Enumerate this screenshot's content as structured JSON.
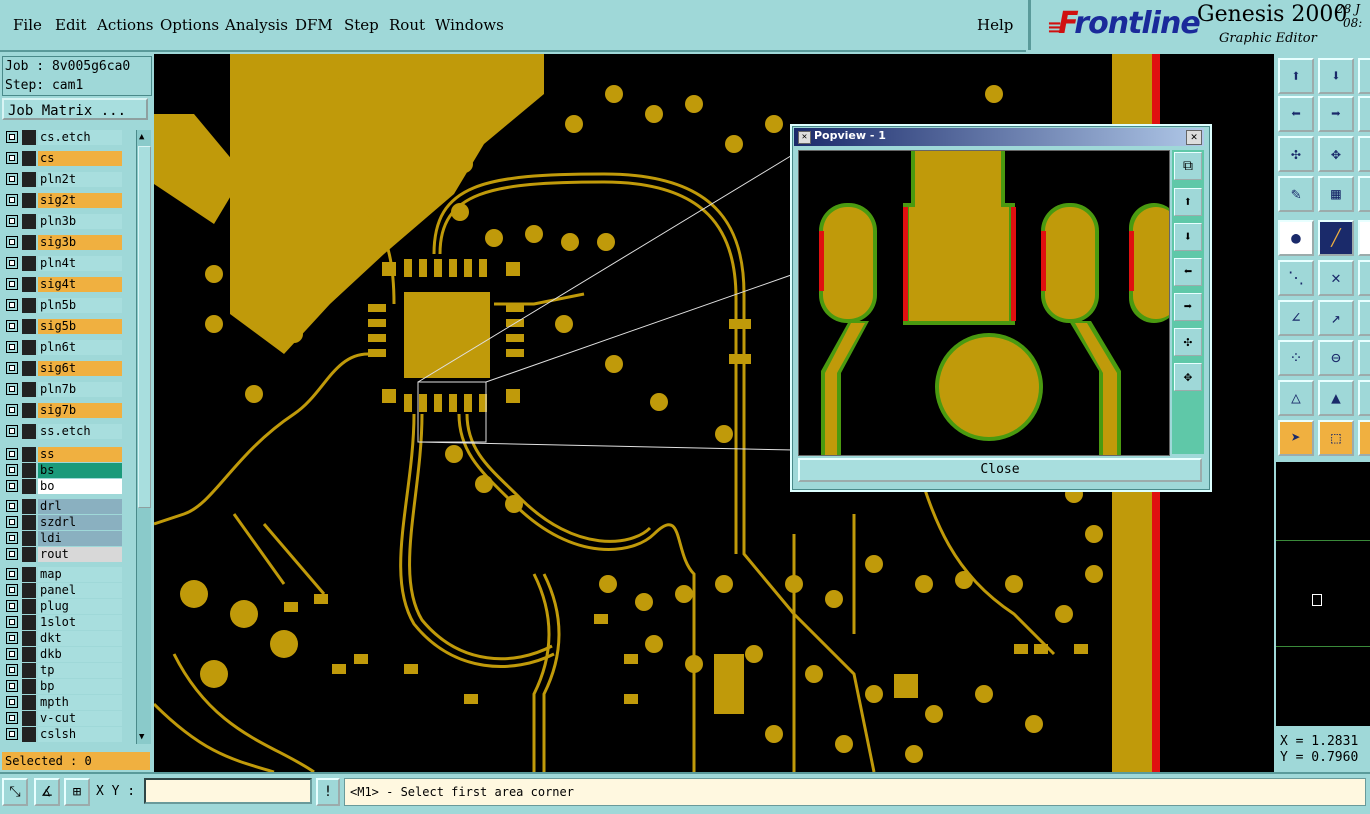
{
  "menu": {
    "file": "File",
    "edit": "Edit",
    "actions": "Actions",
    "options": "Options",
    "analysis": "Analysis",
    "dfm": "DFM",
    "step": "Step",
    "rout": "Rout",
    "windows": "Windows",
    "help": "Help"
  },
  "brand": {
    "logo_f": "F",
    "logo_rest": "rontline",
    "product": "Genesis 2000",
    "subtitle": "Graphic Editor",
    "date1": "28 J",
    "date2": "08:"
  },
  "job": {
    "job_label": "Job : 8v005g6ca0",
    "step_label": "Step: cam1",
    "matrix_button": "Job Matrix ..."
  },
  "layers": [
    {
      "name": "cs.etch",
      "color": "#a8dede"
    },
    {
      "name": "cs",
      "color": "#f0b040"
    },
    {
      "name": "pln2t",
      "color": "#a8dede"
    },
    {
      "name": "sig2t",
      "color": "#f0b040"
    },
    {
      "name": "pln3b",
      "color": "#a8dede"
    },
    {
      "name": "sig3b",
      "color": "#f0b040"
    },
    {
      "name": "pln4t",
      "color": "#a8dede"
    },
    {
      "name": "sig4t",
      "color": "#f0b040"
    },
    {
      "name": "pln5b",
      "color": "#a8dede"
    },
    {
      "name": "sig5b",
      "color": "#f0b040"
    },
    {
      "name": "pln6t",
      "color": "#a8dede"
    },
    {
      "name": "sig6t",
      "color": "#f0b040"
    },
    {
      "name": "pln7b",
      "color": "#a8dede"
    },
    {
      "name": "sig7b",
      "color": "#f0b040"
    },
    {
      "name": "ss.etch",
      "color": "#a8dede"
    },
    {
      "name": "ss",
      "color": "#f0b040"
    },
    {
      "name": "bs",
      "color": "#1a9a7a"
    },
    {
      "name": "bo",
      "color": "#ffffff"
    },
    {
      "name": "drl",
      "color": "#8ab0c0"
    },
    {
      "name": "szdrl",
      "color": "#8ab0c0"
    },
    {
      "name": "ldi",
      "color": "#8ab0c0"
    },
    {
      "name": "rout",
      "color": "#d8d8d8"
    },
    {
      "name": "map",
      "color": "#a8dede"
    },
    {
      "name": "panel",
      "color": "#a8dede"
    },
    {
      "name": "plug",
      "color": "#a8dede"
    },
    {
      "name": "1slot",
      "color": "#a8dede"
    },
    {
      "name": "dkt",
      "color": "#a8dede"
    },
    {
      "name": "dkb",
      "color": "#a8dede"
    },
    {
      "name": "tp",
      "color": "#a8dede"
    },
    {
      "name": "bp",
      "color": "#a8dede"
    },
    {
      "name": "mpth",
      "color": "#a8dede"
    },
    {
      "name": "v-cut",
      "color": "#a8dede"
    },
    {
      "name": "cslsh",
      "color": "#a8dede"
    }
  ],
  "selected_label": "Selected : 0",
  "popview": {
    "title": "Popview - 1",
    "close_label": "Close"
  },
  "coords": {
    "x": "X = 1.2831",
    "y": "Y = 0.7960"
  },
  "bottom": {
    "xy_label": "X Y :",
    "xy_value": "",
    "message": "<M1> - Select first area corner"
  },
  "colors": {
    "copper": "#c09a0a",
    "board": "#000000",
    "panel": "#9fd8d8",
    "highlight": "#f0b040",
    "edge_red": "#e01010",
    "edge_green": "#4a9a10"
  }
}
